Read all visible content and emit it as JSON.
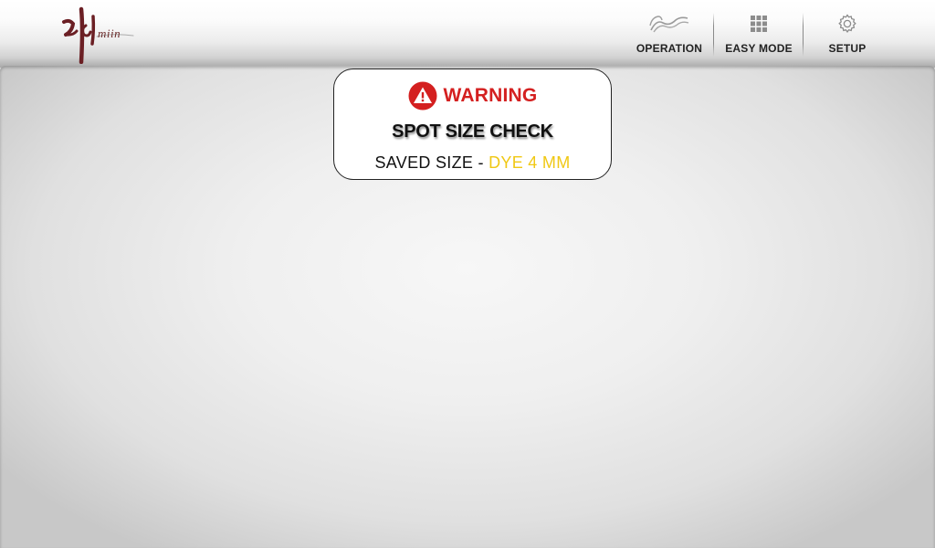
{
  "brand": {
    "logo_text": "미인",
    "logo_sub": "miin"
  },
  "nav": {
    "operation": {
      "label": "OPERATION",
      "icon": "wave-icon"
    },
    "easy_mode": {
      "label": "EASY MODE",
      "icon": "grid-icon"
    },
    "setup": {
      "label": "SETUP",
      "icon": "gear-icon"
    }
  },
  "dialog": {
    "title": "WARNING",
    "heading": "SPOT SIZE CHECK",
    "saved_label": "SAVED SIZE",
    "separator": " - ",
    "saved_value": "DYE 4 MM"
  },
  "colors": {
    "warning_red": "#d42020",
    "value_yellow": "#f0c814",
    "logo_maroon": "#6b1f24"
  }
}
